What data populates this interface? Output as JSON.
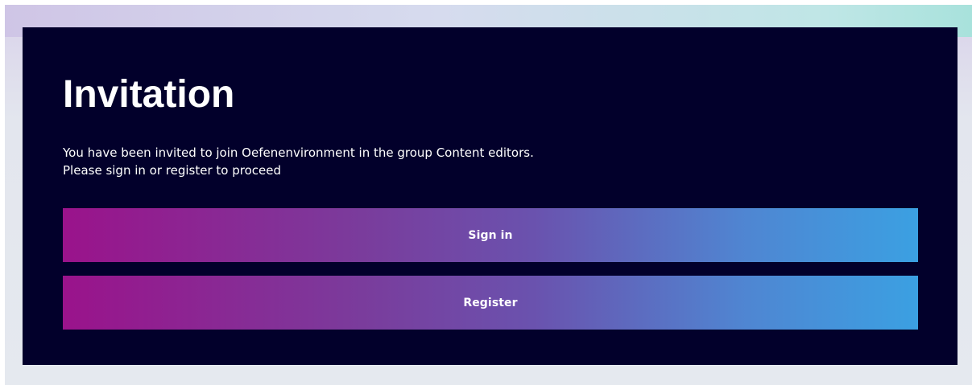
{
  "invitation": {
    "title": "Invitation",
    "message_line1": "You have been invited to join Oefenenvironment in the group Content editors.",
    "message_line2": "Please sign in or register to proceed",
    "signin_label": "Sign in",
    "register_label": "Register"
  },
  "colors": {
    "card_background": "#02002b",
    "button_gradient_start": "#9a138b",
    "button_gradient_end": "#3ba0e2",
    "text": "#ffffff"
  }
}
